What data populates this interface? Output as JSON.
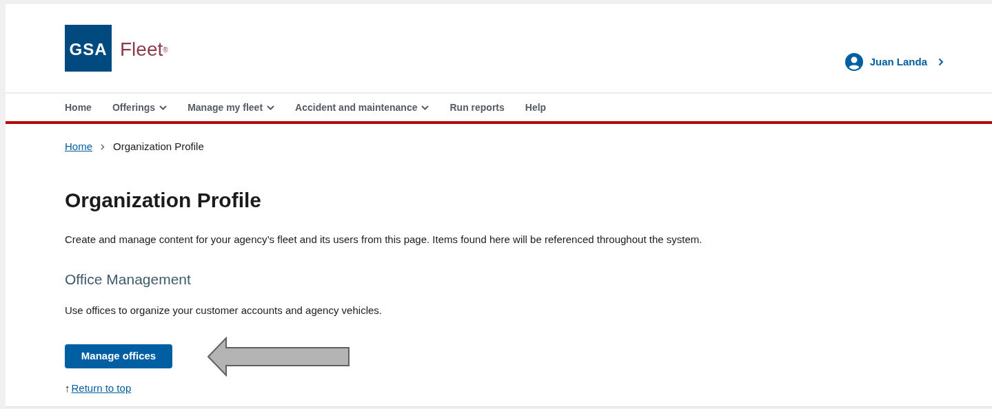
{
  "header": {
    "logo_text": "GSA",
    "brand": "Fleet$^{®}$",
    "user": {
      "name": "Juan Landa"
    }
  },
  "nav": [
    {
      "label": "Home",
      "dropdown": false
    },
    {
      "label": "Offerings",
      "dropdown": true
    },
    {
      "label": "Manage my fleet",
      "dropdown": true
    },
    {
      "label": "Accident and maintenance",
      "dropdown": true
    },
    {
      "label": "Run reports",
      "dropdown": false
    },
    {
      "label": "Help",
      "dropdown": false
    }
  ],
  "breadcrumb": [
    {
      "label": "Home",
      "kind": "link"
    },
    {
      "label": "Organization Profile",
      "kind": "current"
    }
  ],
  "title": "Organization Profile",
  "intro": "Create and manage content for your agency’s fleet and its users from this page. Items found here will be referenced throughout the system.",
  "section": {
    "heading": "Office Management",
    "text": "Use offices to organize your customer accounts and agency vehicles.",
    "button": "Manage offices"
  },
  "return_link": {
    "icon": "↑",
    "label": "Return to top"
  }
}
